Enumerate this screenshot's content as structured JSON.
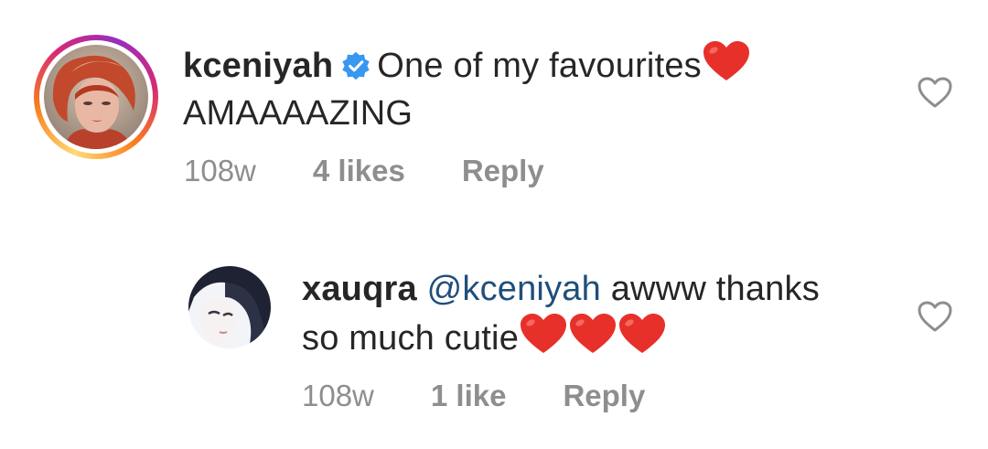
{
  "comments": [
    {
      "username": "kceniyah",
      "verified": true,
      "text_line1": "One of my favourites",
      "text_line2": "AMAAAAZING",
      "time": "108w",
      "likes": "4 likes",
      "reply_label": "Reply",
      "heart_color": "#e8302a"
    },
    {
      "username": "xauqra",
      "mention": "@kceniyah",
      "text_line1": "awww thanks",
      "text_line2": "so much cutie",
      "time": "108w",
      "likes": "1 like",
      "reply_label": "Reply"
    }
  ],
  "colors": {
    "text": "#262626",
    "meta": "#8e8e8e",
    "mention": "#1f4f7a",
    "verified": "#3897f0",
    "heart": "#e8302a",
    "like_outline": "#8e8e8e"
  }
}
